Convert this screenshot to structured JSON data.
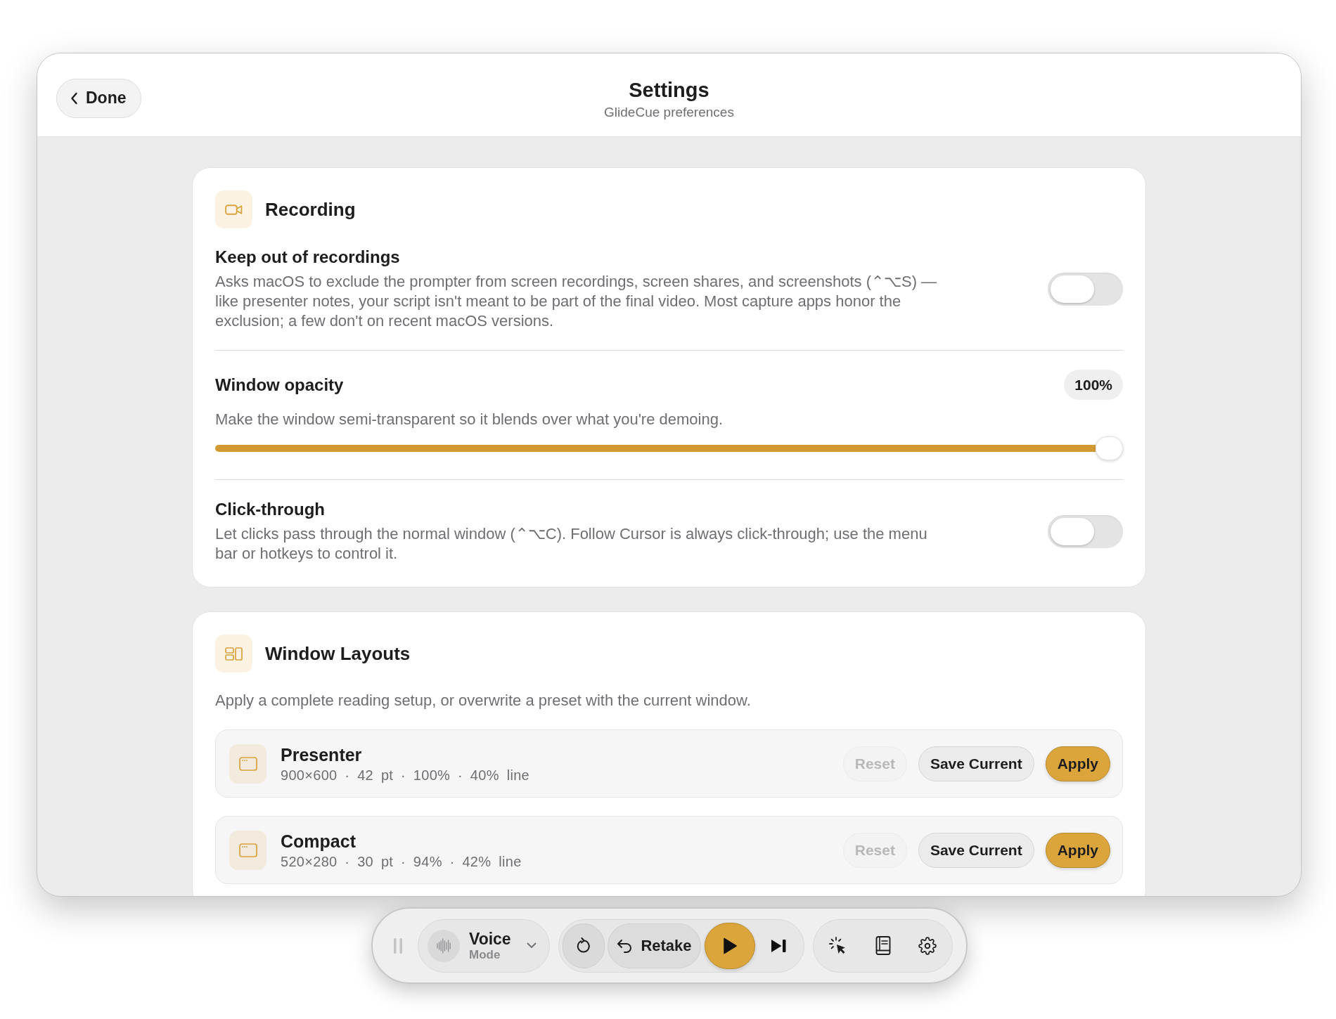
{
  "window": {
    "title": "Settings",
    "subtitle": "GlideCue preferences",
    "back_button": "Done"
  },
  "sections": [
    {
      "kind": "settings",
      "title": "Recording",
      "items": [
        {
          "kind": "toggle",
          "title": "Keep out of recordings",
          "description": "Asks macOS to exclude the prompter from screen recordings, screen shares, and screenshots (⌃⌥S) — like presenter notes, your script isn't meant to be part of the final video. Most capture apps honor the exclusion; a few don't on recent macOS versions.",
          "on": false
        },
        {
          "kind": "slider",
          "title": "Window opacity",
          "value": "100%",
          "description": "Make the window semi-transparent so it blends over what you're demoing.",
          "level": 1
        },
        {
          "kind": "toggle",
          "title": "Click-through",
          "description": "Let clicks pass through the normal window (⌃⌥C). Follow Cursor is always click-through; use the menu bar or hotkeys to control it.",
          "on": false
        }
      ]
    },
    {
      "kind": "presets",
      "title": "Window Layouts",
      "description": "Apply a complete reading setup, or overwrite a preset with the current window.",
      "presets": [
        {
          "name": "Presenter",
          "details": "900×600 · 42 pt · 100% · 40% line",
          "buttons": [
            {
              "kind": "plain",
              "label": "Reset",
              "disabled": true
            },
            {
              "kind": "plain",
              "label": "Save Current",
              "disabled": false
            },
            {
              "kind": "primary",
              "label": "Apply",
              "disabled": false
            }
          ]
        },
        {
          "name": "Compact",
          "details": "520×280 · 30 pt · 94% · 42% line",
          "buttons": [
            {
              "kind": "plain",
              "label": "Reset",
              "disabled": true
            },
            {
              "kind": "plain",
              "label": "Save Current",
              "disabled": false
            },
            {
              "kind": "primary",
              "label": "Apply",
              "disabled": false
            }
          ]
        }
      ]
    }
  ],
  "toolbar": {
    "mode": {
      "label": "Voice",
      "sublabel": "Mode"
    },
    "retake_button": "Retake"
  }
}
